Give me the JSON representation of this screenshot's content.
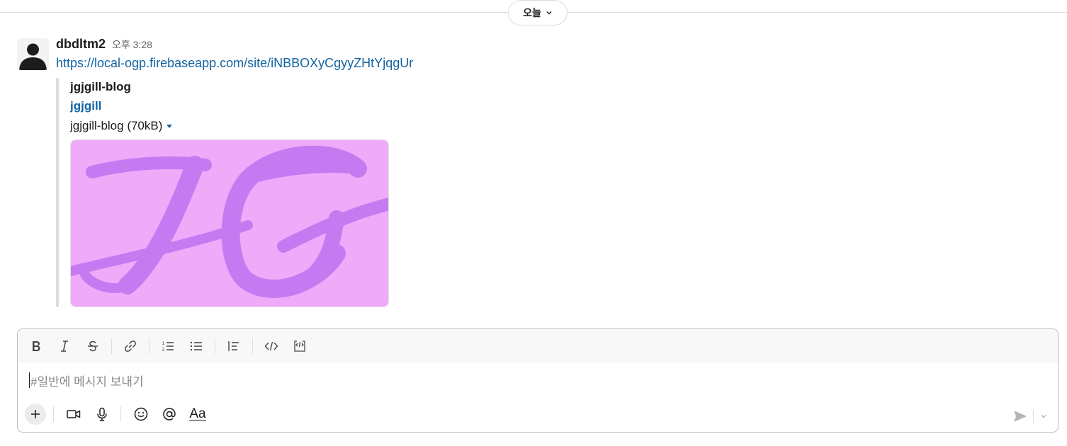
{
  "date_divider": {
    "label": "오늘"
  },
  "message": {
    "username": "dbdltm2",
    "timestamp": "오후 3:28",
    "link": "https://local-ogp.firebaseapp.com/site/iNBBOXyCgyyZHtYjqgUr",
    "unfurl": {
      "title": "jgjgill-blog",
      "site_link": "jgjgill",
      "file_label": "jgjgill-blog (70kB)",
      "image_text": "JG",
      "image_bg": "#efaafa",
      "image_fg": "#c67af2"
    }
  },
  "composer": {
    "placeholder": "#일반에 메시지 보내기",
    "format_buttons": [
      "bold-icon",
      "italic-icon",
      "strikethrough-icon",
      "link-icon",
      "ordered-list-icon",
      "bullet-list-icon",
      "blockquote-icon",
      "code-icon",
      "code-block-icon"
    ],
    "bottom_buttons": [
      "plus-icon",
      "video-icon",
      "microphone-icon",
      "emoji-icon",
      "mention-icon",
      "formatting-icon"
    ],
    "format_label": "Aa"
  },
  "colors": {
    "link": "#1264a3",
    "text": "#1d1c1d",
    "muted": "#616061"
  }
}
